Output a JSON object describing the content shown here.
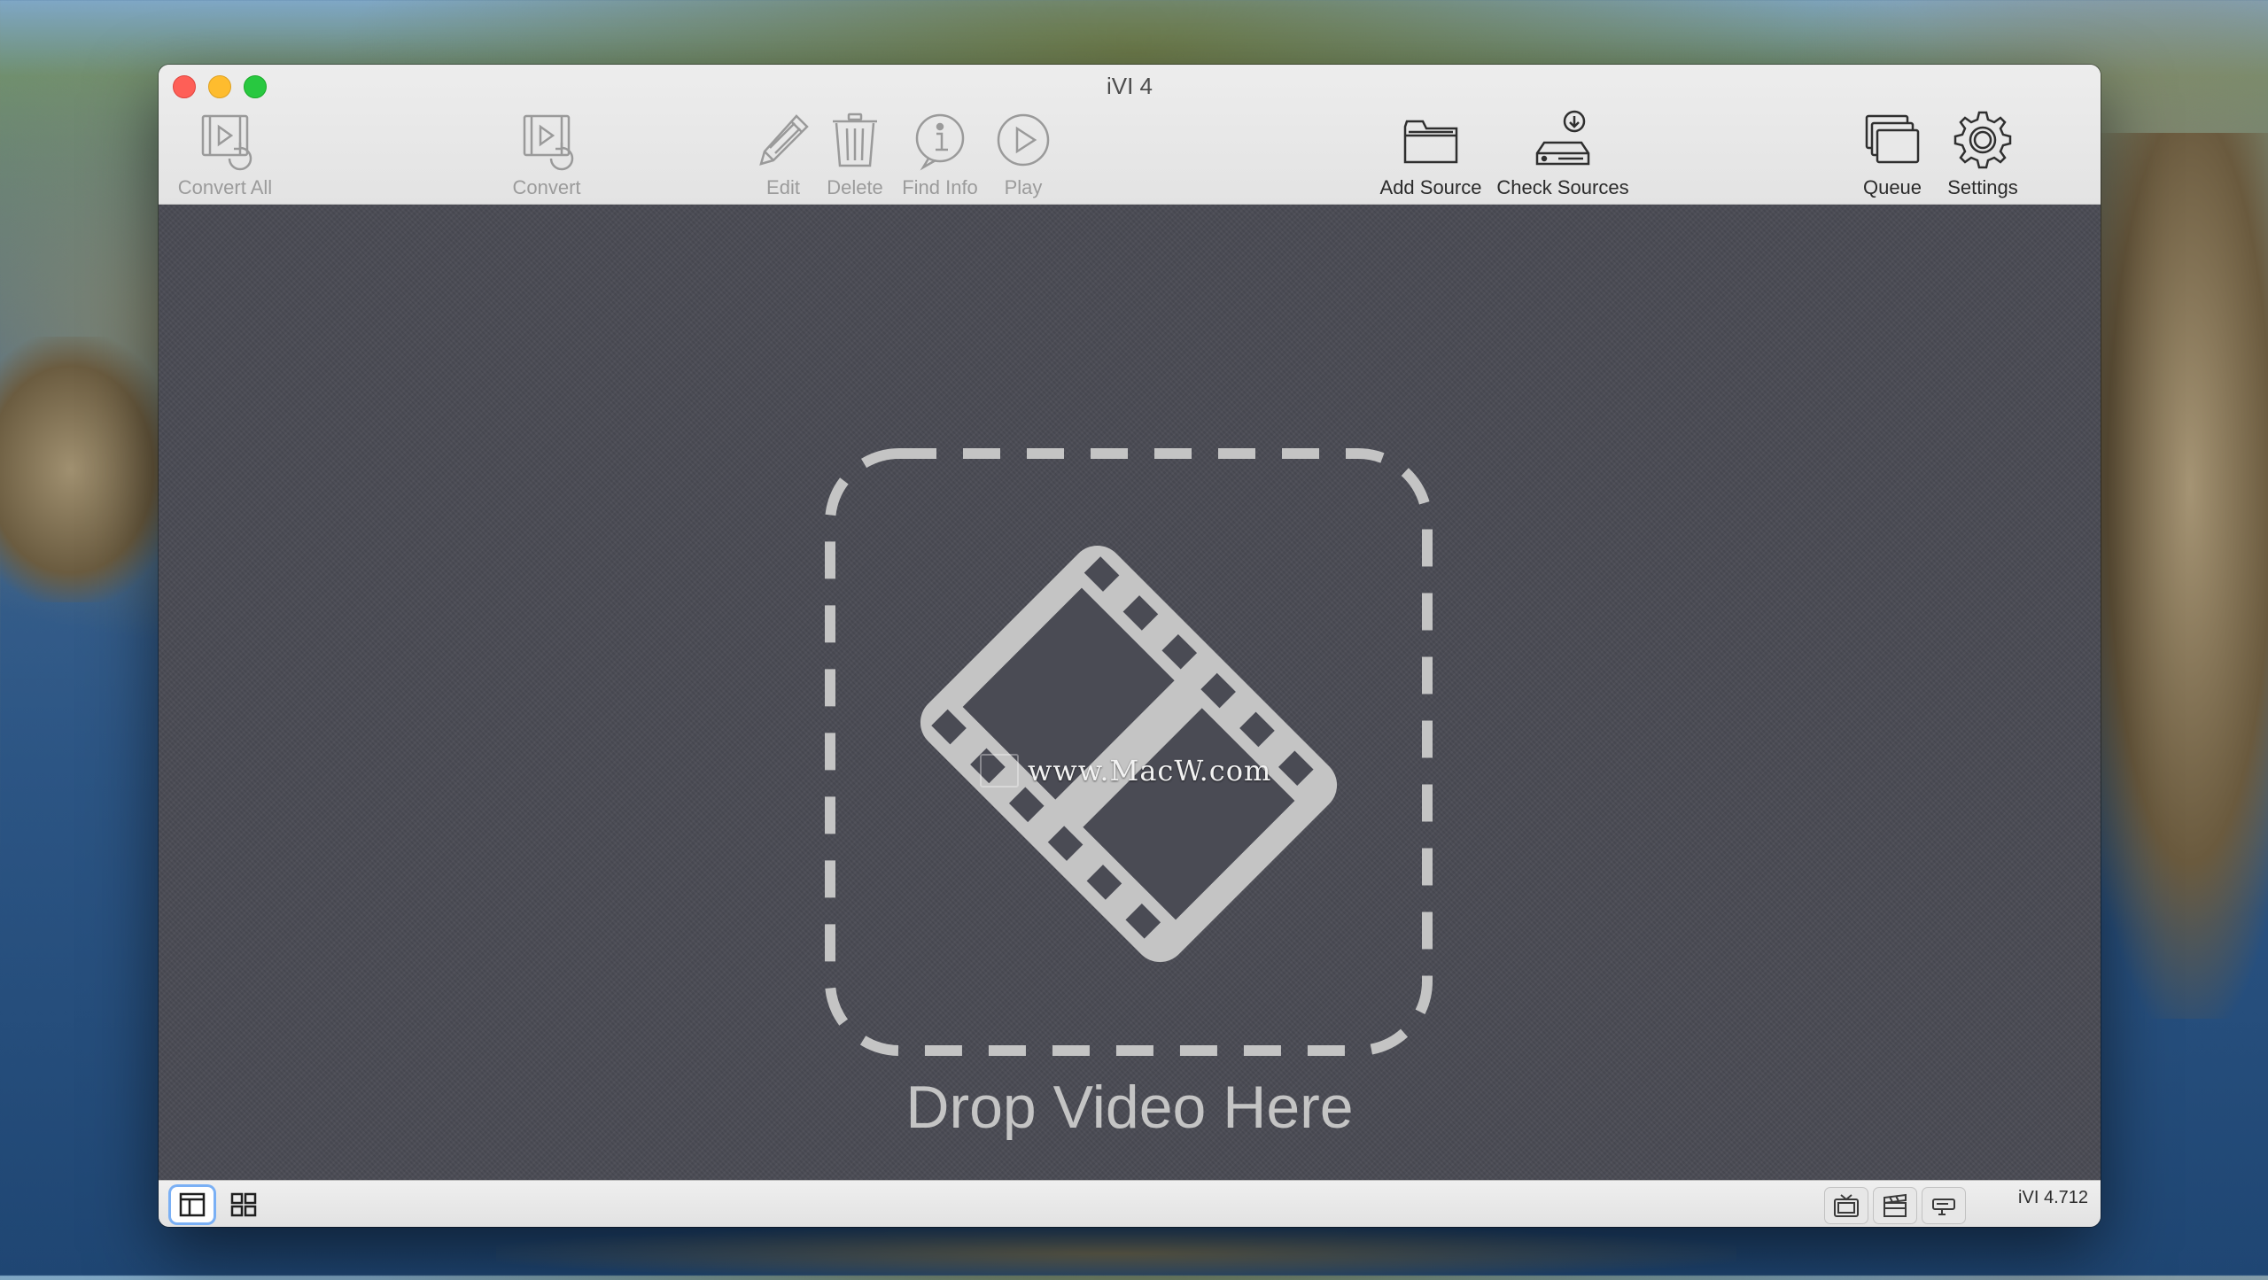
{
  "window": {
    "title": "iVI 4"
  },
  "toolbar": {
    "convert_all": "Convert All",
    "convert": "Convert",
    "edit": "Edit",
    "delete": "Delete",
    "find_info": "Find Info",
    "play": "Play",
    "add_source": "Add Source",
    "check_sources": "Check Sources",
    "queue": "Queue",
    "settings": "Settings"
  },
  "main": {
    "drop_text": "Drop Video Here"
  },
  "watermark": {
    "text": "www.MacW.com"
  },
  "statusbar": {
    "version": "iVI 4.712"
  },
  "colors": {
    "content_bg": "#4a4b54",
    "drop_graphic": "#c4c4c4",
    "active_button_ring": "#7ab0f5"
  }
}
